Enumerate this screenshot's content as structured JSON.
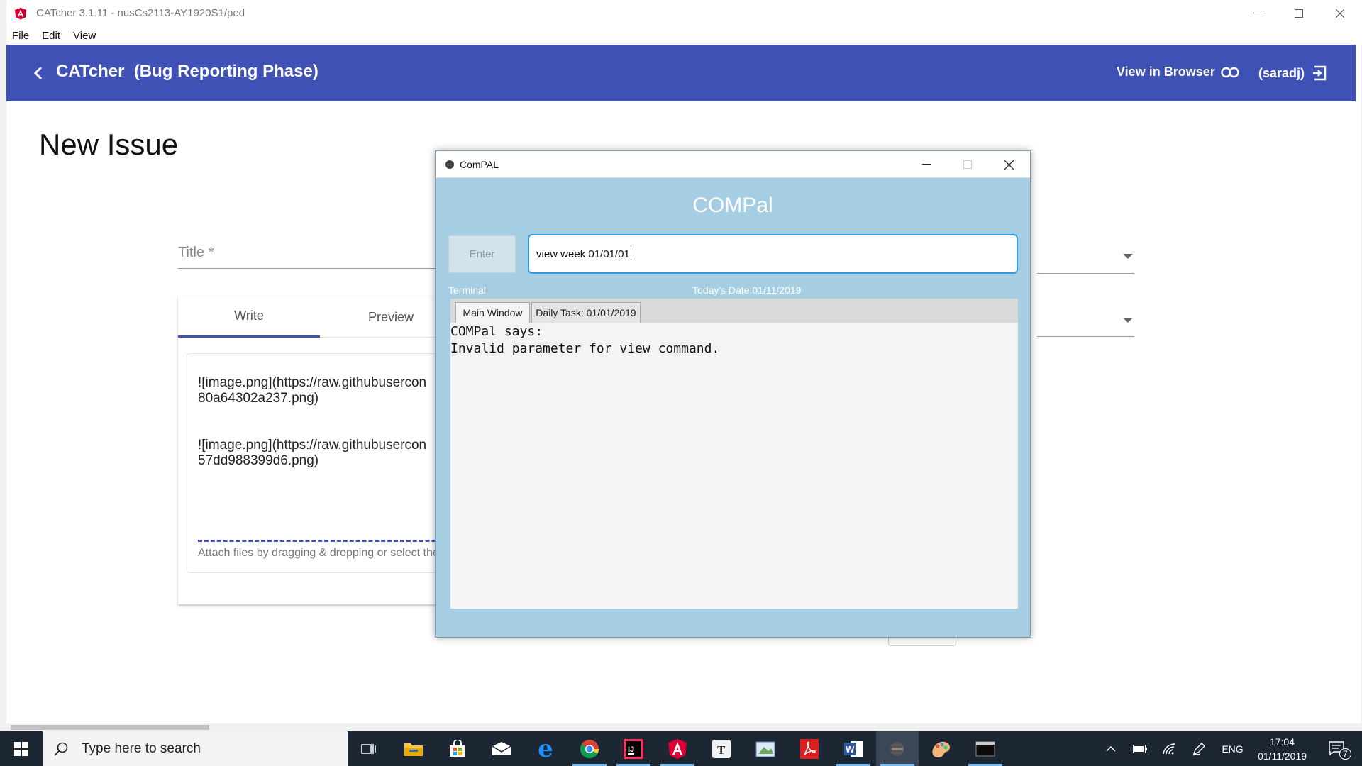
{
  "window": {
    "title": "CATcher 3.1.11 - nusCs2113-AY1920S1/ped",
    "menu": [
      "File",
      "Edit",
      "View"
    ]
  },
  "toolbar": {
    "app_title": "CATcher",
    "phase": "(Bug Reporting Phase)",
    "view_in_browser": "View in Browser",
    "user": "(saradj)",
    "color": "#3f51b5"
  },
  "issue_form": {
    "heading": "New Issue",
    "title_placeholder": "Title *",
    "tabs": [
      "Write",
      "Preview"
    ],
    "editor_lines": [
      "![image.png](https://raw.githubusercon",
      "80a64302a237.png)",
      "![image.png](https://raw.githubusercon",
      "57dd988399d6.png)"
    ],
    "attach_hint": "Attach files by dragging & dropping or select the"
  },
  "compal": {
    "window_title": "ComPAL",
    "heading": "COMPal",
    "enter_label": "Enter",
    "command_value": "view week 01/01/01",
    "terminal_label": "Terminal",
    "date_label": "Today's Date:01/11/2019",
    "tabs": [
      "Main Window",
      "Daily Task: 01/01/2019"
    ],
    "output": [
      "COMPal says:",
      "Invalid parameter for view command."
    ],
    "background_color": "#a6cee3",
    "input_border_color": "#2f9be6"
  },
  "taskbar": {
    "search_placeholder": "Type here to search",
    "language": "ENG",
    "time": "17:04",
    "date": "01/11/2019",
    "notification_count": "7",
    "apps": [
      "task-view-icon",
      "file-explorer-icon",
      "store-icon",
      "mail-icon",
      "edge-icon",
      "chrome-icon",
      "intellij-icon",
      "angular-icon",
      "typora-icon",
      "paint-icon",
      "acrobat-icon",
      "word-icon",
      "compal-icon",
      "paint3d-icon",
      "terminal-icon"
    ],
    "background_color": "#1d2633"
  }
}
